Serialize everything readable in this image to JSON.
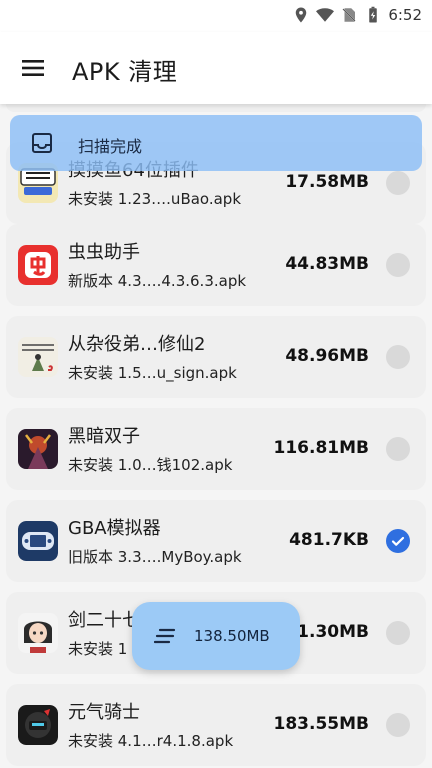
{
  "status_bar": {
    "time": "6:52"
  },
  "app_bar": {
    "title": "APK 清理"
  },
  "toast": {
    "text": "扫描完成"
  },
  "apks": [
    {
      "name": "摸摸鱼64位插件",
      "file": "未安装 1.23….uBao.apk",
      "size": "17.58MB",
      "checked": false,
      "icon": "momoyu-plugin-icon"
    },
    {
      "name": "虫虫助手",
      "file": "新版本 4.3….4.3.6.3.apk",
      "size": "44.83MB",
      "checked": false,
      "icon": "chongchong-icon"
    },
    {
      "name": "从杂役弟…修仙2",
      "file": "未安装 1.5…u_sign.apk",
      "size": "48.96MB",
      "checked": false,
      "icon": "xiuxian-game-icon"
    },
    {
      "name": "黑暗双子",
      "file": "未安装 1.0…钱102.apk",
      "size": "116.81MB",
      "checked": false,
      "icon": "dark-twins-icon"
    },
    {
      "name": "GBA模拟器",
      "file": "旧版本 3.3….MyBoy.apk",
      "size": "481.7KB",
      "checked": true,
      "icon": "gba-emulator-icon"
    },
    {
      "name": "剑二十七",
      "file": "未安装 1",
      "size": "1.30MB",
      "checked": false,
      "icon": "sword-girl-icon"
    },
    {
      "name": "元气骑士",
      "file": "未安装 4.1…r4.1.8.apk",
      "size": "183.55MB",
      "checked": false,
      "icon": "soul-knight-icon"
    }
  ],
  "fab": {
    "total": "138.50MB"
  },
  "colors": {
    "accent": "#2f6fe0",
    "toast_bg": "#8cbef6",
    "fab_bg": "#9ccaf6",
    "card_bg": "#efefef"
  }
}
